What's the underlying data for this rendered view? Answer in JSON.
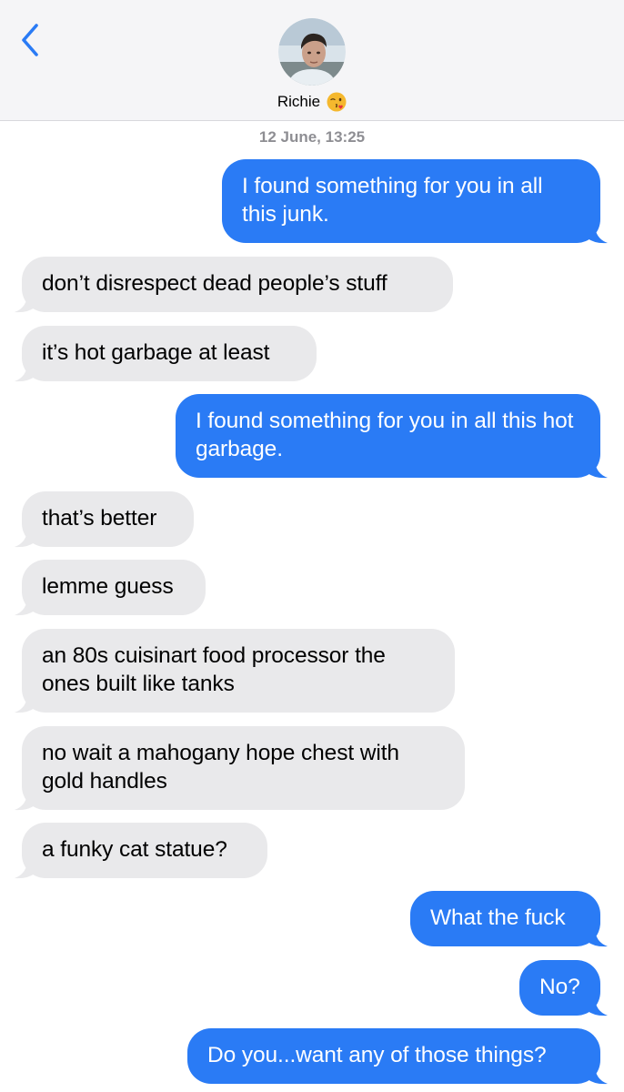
{
  "contact": {
    "name": "Richie"
  },
  "timestamp": "12 June, 13:25",
  "colors": {
    "sent": "#2a7bf5",
    "received": "#e9e9eb",
    "link": "#2a7bf5",
    "header": "#f5f5f7"
  },
  "messages": [
    {
      "side": "sent",
      "text": "I found something for you in all this junk."
    },
    {
      "side": "received",
      "text": "don’t disrespect dead people’s stuff"
    },
    {
      "side": "received",
      "text": "it’s hot garbage at least"
    },
    {
      "side": "sent",
      "text": "I found something for you in all this hot garbage."
    },
    {
      "side": "received",
      "text": "that’s better"
    },
    {
      "side": "received",
      "text": "lemme guess"
    },
    {
      "side": "received",
      "text": "an 80s cuisinart food processor the ones built like tanks"
    },
    {
      "side": "received",
      "text": "no wait a mahogany hope chest with gold handles"
    },
    {
      "side": "received",
      "text": "a funky cat statue?"
    },
    {
      "side": "sent",
      "text": "What the fuck"
    },
    {
      "side": "sent",
      "text": "No?"
    },
    {
      "side": "sent",
      "text": "Do you...want any of those things?"
    }
  ]
}
